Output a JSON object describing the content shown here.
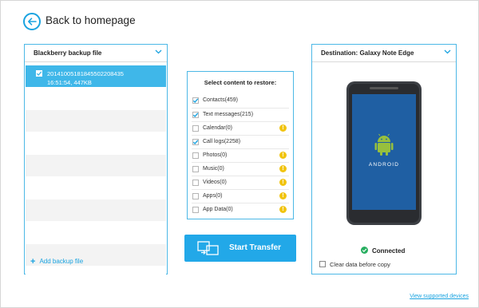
{
  "header": {
    "back_label": "Back to homepage"
  },
  "source": {
    "title": "Blackberry backup file",
    "selected": {
      "name": "20141005181845502208435",
      "meta": "16:51:54,   447KB"
    },
    "empty_rows": 9,
    "add_label": "Add backup file"
  },
  "content": {
    "title": "Select content to restore:",
    "items": [
      {
        "label": "Contacts(459)",
        "checked": true,
        "warning": false
      },
      {
        "label": "Text messages(215)",
        "checked": true,
        "warning": false
      },
      {
        "label": "Calendar(0)",
        "checked": false,
        "warning": true
      },
      {
        "label": "Call logs(2258)",
        "checked": true,
        "warning": false
      },
      {
        "label": "Photos(0)",
        "checked": false,
        "warning": true
      },
      {
        "label": "Music(0)",
        "checked": false,
        "warning": true
      },
      {
        "label": "Videos(0)",
        "checked": false,
        "warning": true
      },
      {
        "label": "Apps(0)",
        "checked": false,
        "warning": true
      },
      {
        "label": "App Data(0)",
        "checked": false,
        "warning": true
      }
    ]
  },
  "transfer": {
    "label": "Start Transfer"
  },
  "destination": {
    "title": "Destination: Galaxy Note Edge",
    "phone_brand": "ANDROID",
    "status": "Connected",
    "clear_label": "Clear data before copy"
  },
  "footer": {
    "link": "View supported devices"
  },
  "colors": {
    "accent": "#1aa3e0",
    "selected_row": "#3fb7e9",
    "warning": "#f1c40f",
    "connected": "#27ae60"
  }
}
